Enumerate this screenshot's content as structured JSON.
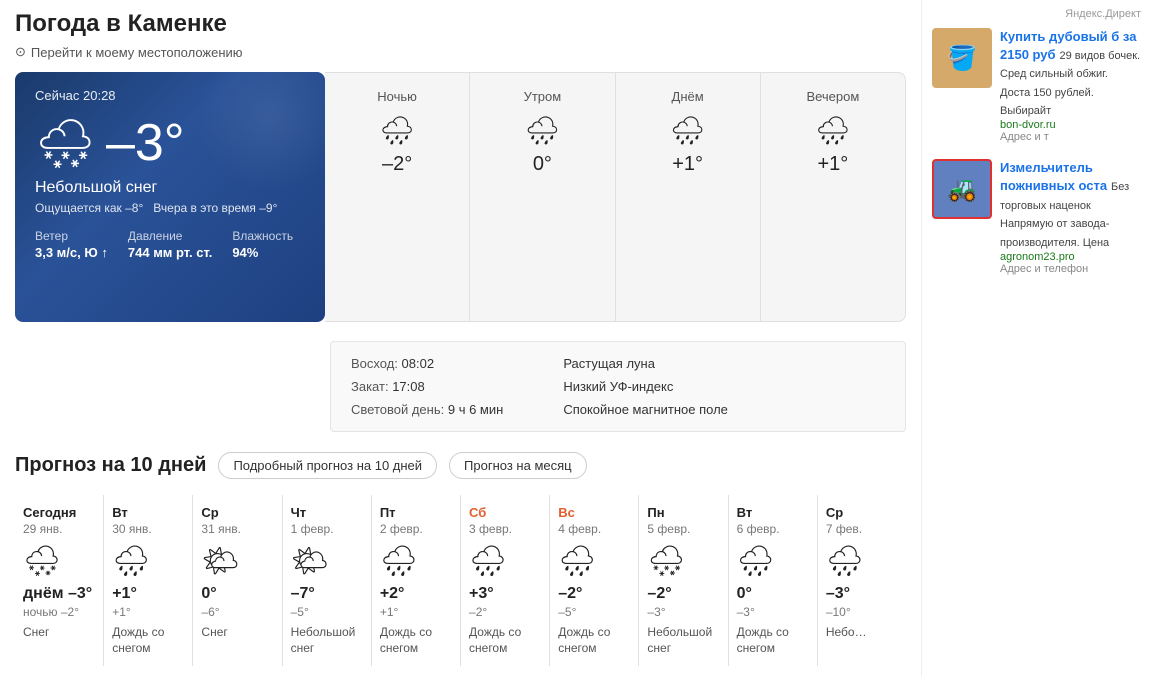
{
  "page": {
    "title": "Погода в Каменке",
    "location_link": "Перейти к моему местоположению"
  },
  "current": {
    "time": "Сейчас 20:28",
    "temp": "–3°",
    "icon": "🌨",
    "description": "Небольшой снег",
    "feels_like": "Ощущается как –8°",
    "yesterday": "Вчера в это время –9°",
    "wind_label": "Ветер",
    "wind_value": "3,3 м/с, Ю ↑",
    "pressure_label": "Давление",
    "pressure_value": "744 мм рт. ст.",
    "humidity_label": "Влажность",
    "humidity_value": "94%"
  },
  "periods": [
    {
      "name": "Ночью",
      "icon": "🌧",
      "temp": "–2°"
    },
    {
      "name": "Утром",
      "icon": "🌧",
      "temp": "0°"
    },
    {
      "name": "Днём",
      "icon": "🌧",
      "temp": "+1°"
    },
    {
      "name": "Вечером",
      "icon": "🌧",
      "temp": "+1°"
    }
  ],
  "sun_info": {
    "sunrise_label": "Восход:",
    "sunrise_value": "08:02",
    "sunset_label": "Закат:",
    "sunset_value": "17:08",
    "daylight_label": "Световой день:",
    "daylight_value": "9 ч 6 мин",
    "moon_label": "Растущая луна",
    "uv_label": "Низкий УФ-индекс",
    "magnetic_label": "Спокойное магнитное поле"
  },
  "forecast": {
    "title": "Прогноз на 10 дней",
    "btn_detail": "Подробный прогноз на 10 дней",
    "btn_month": "Прогноз на месяц",
    "days": [
      {
        "name": "Сегодня",
        "date": "29 янв.",
        "icon": "🌨",
        "high": "днём –3°",
        "low": "ночью –2°",
        "desc": "Снег",
        "weekend": false
      },
      {
        "name": "Вт",
        "date": "30 янв.",
        "icon": "🌧",
        "high": "+1°",
        "low": "+1°",
        "desc": "Дождь со снегом",
        "weekend": false
      },
      {
        "name": "Ср",
        "date": "31 янв.",
        "icon": "🌤",
        "high": "0°",
        "low": "–6°",
        "desc": "Снег",
        "weekend": false
      },
      {
        "name": "Чт",
        "date": "1 февр.",
        "icon": "🌤",
        "high": "–7°",
        "low": "–5°",
        "desc": "Небольшой снег",
        "weekend": false
      },
      {
        "name": "Пт",
        "date": "2 февр.",
        "icon": "🌧",
        "high": "+2°",
        "low": "+1°",
        "desc": "Дождь со снегом",
        "weekend": false
      },
      {
        "name": "Сб",
        "date": "3 февр.",
        "icon": "🌧",
        "high": "+3°",
        "low": "–2°",
        "desc": "Дождь со снегом",
        "weekend": true
      },
      {
        "name": "Вс",
        "date": "4 февр.",
        "icon": "🌧",
        "high": "–2°",
        "low": "–5°",
        "desc": "Дождь со снегом",
        "weekend": true
      },
      {
        "name": "Пн",
        "date": "5 февр.",
        "icon": "🌨",
        "high": "–2°",
        "low": "–3°",
        "desc": "Небольшой снег",
        "weekend": false
      },
      {
        "name": "Вт",
        "date": "6 февр.",
        "icon": "🌧",
        "high": "0°",
        "low": "–3°",
        "desc": "Дождь со снегом",
        "weekend": false
      },
      {
        "name": "Ср",
        "date": "7 фев.",
        "icon": "🌧",
        "high": "–3°",
        "low": "–10°",
        "desc": "Небо…",
        "weekend": false
      }
    ]
  },
  "ads": {
    "label": "Яндекс.Директ",
    "ad1": {
      "title": "Купить дубовый б за 2150 руб",
      "desc": "29 видов бочек. Сред сильный обжиг. Доста 150 рублей. Выбирайт",
      "link": "bon-dvor.ru",
      "addr": "Адрес и т"
    },
    "ad2": {
      "title": "Измельчитель пожнивных оста",
      "desc": "Без торговых наценок Напрямую от завода-производителя. Цена",
      "link": "agronom23.pro",
      "addr": "Адрес и телефон"
    }
  }
}
